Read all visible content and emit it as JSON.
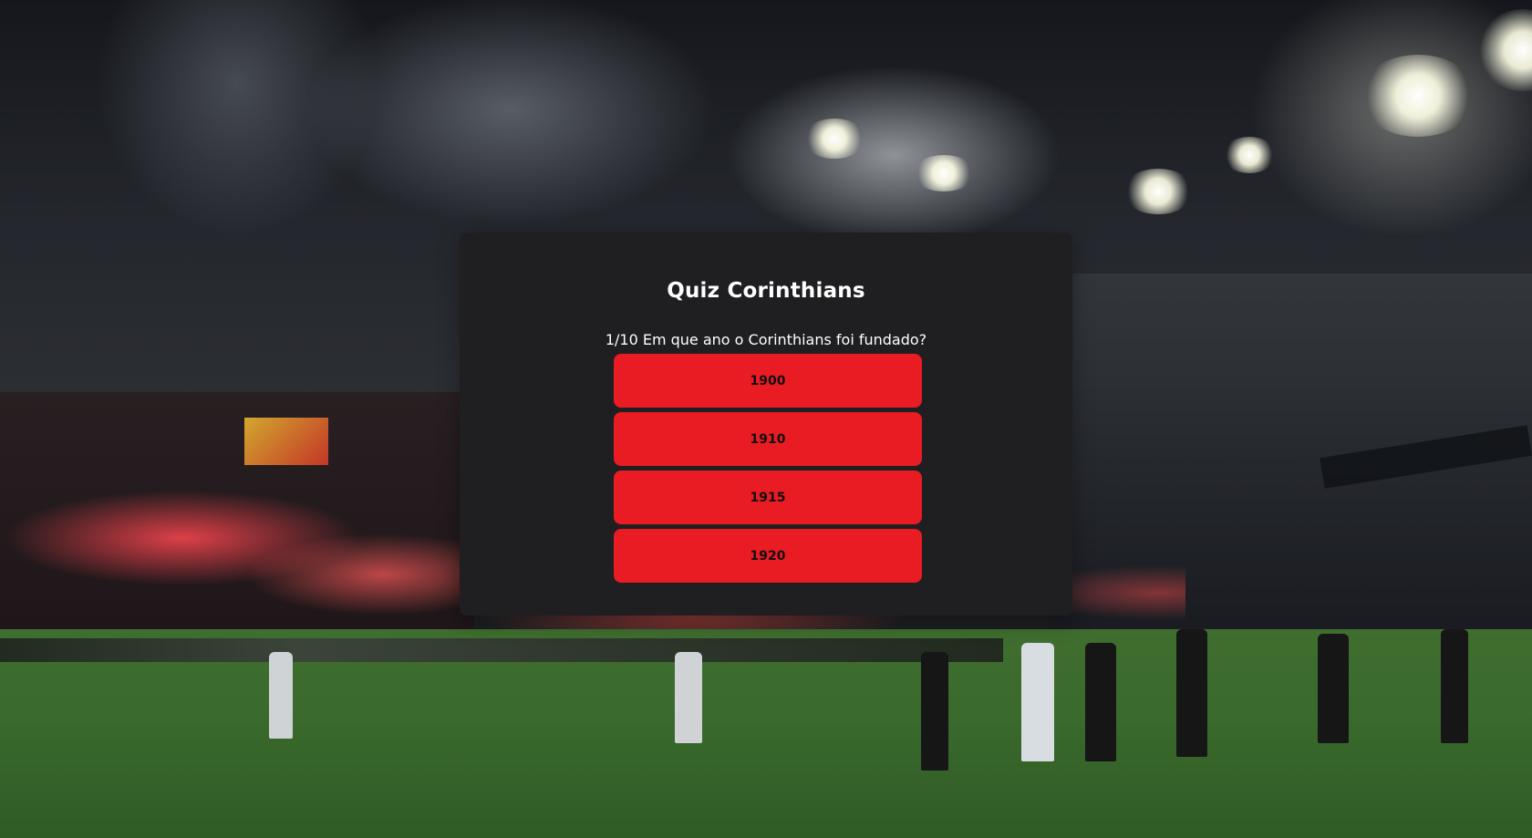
{
  "quiz": {
    "title": "Quiz Corinthians",
    "progress": "1/10",
    "question": "Em que ano o Corinthians foi fundado?",
    "answers": [
      "1900",
      "1910",
      "1915",
      "1920"
    ]
  },
  "colors": {
    "card_background": "#1f1f21",
    "answer_button": "#e91b23",
    "title_text": "#ffffff"
  }
}
